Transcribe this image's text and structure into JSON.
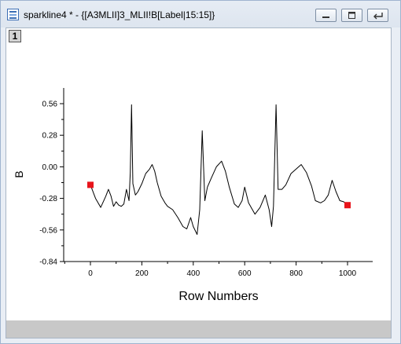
{
  "window": {
    "title": "sparkline4 * - {[A3MLII]3_MLII!B[Label|15:15]}",
    "layer_tab": "1",
    "buttons": [
      "minimize",
      "maximize",
      "restore"
    ]
  },
  "chart_data": {
    "type": "line",
    "title": "",
    "xlabel": "Row Numbers",
    "ylabel": "B",
    "xlim": [
      -100,
      1100
    ],
    "ylim": [
      -0.84,
      0.7
    ],
    "x_ticks": [
      0,
      200,
      400,
      600,
      800,
      1000
    ],
    "y_ticks": [
      0.56,
      0.28,
      0.0,
      -0.28,
      -0.56,
      -0.84
    ],
    "y_tick_labels": [
      "0.56",
      "0.28",
      "0.00",
      "-0.28",
      "-0.56",
      "-0.84"
    ],
    "line_color": "#000000",
    "marker_color": "#e8141b",
    "series": [
      {
        "points": [
          [
            0,
            -0.16
          ],
          [
            20,
            -0.28
          ],
          [
            40,
            -0.36
          ],
          [
            60,
            -0.26
          ],
          [
            70,
            -0.2
          ],
          [
            80,
            -0.26
          ],
          [
            90,
            -0.35
          ],
          [
            100,
            -0.31
          ],
          [
            110,
            -0.34
          ],
          [
            120,
            -0.35
          ],
          [
            130,
            -0.33
          ],
          [
            140,
            -0.2
          ],
          [
            150,
            -0.3
          ],
          [
            155,
            -0.05
          ],
          [
            160,
            0.55
          ],
          [
            165,
            -0.15
          ],
          [
            175,
            -0.25
          ],
          [
            185,
            -0.22
          ],
          [
            200,
            -0.15
          ],
          [
            215,
            -0.06
          ],
          [
            230,
            -0.02
          ],
          [
            240,
            0.02
          ],
          [
            250,
            -0.04
          ],
          [
            260,
            -0.14
          ],
          [
            275,
            -0.26
          ],
          [
            290,
            -0.32
          ],
          [
            300,
            -0.35
          ],
          [
            320,
            -0.38
          ],
          [
            340,
            -0.45
          ],
          [
            360,
            -0.53
          ],
          [
            375,
            -0.55
          ],
          [
            390,
            -0.45
          ],
          [
            400,
            -0.53
          ],
          [
            415,
            -0.6
          ],
          [
            425,
            -0.38
          ],
          [
            435,
            0.32
          ],
          [
            445,
            -0.3
          ],
          [
            455,
            -0.18
          ],
          [
            470,
            -0.1
          ],
          [
            490,
            0.0
          ],
          [
            510,
            0.05
          ],
          [
            525,
            -0.04
          ],
          [
            540,
            -0.18
          ],
          [
            560,
            -0.33
          ],
          [
            575,
            -0.36
          ],
          [
            590,
            -0.3
          ],
          [
            600,
            -0.18
          ],
          [
            615,
            -0.32
          ],
          [
            640,
            -0.42
          ],
          [
            660,
            -0.36
          ],
          [
            680,
            -0.25
          ],
          [
            695,
            -0.38
          ],
          [
            705,
            -0.53
          ],
          [
            712,
            -0.35
          ],
          [
            722,
            0.55
          ],
          [
            730,
            -0.2
          ],
          [
            745,
            -0.2
          ],
          [
            760,
            -0.16
          ],
          [
            780,
            -0.06
          ],
          [
            800,
            -0.02
          ],
          [
            820,
            0.02
          ],
          [
            840,
            -0.05
          ],
          [
            860,
            -0.17
          ],
          [
            875,
            -0.3
          ],
          [
            895,
            -0.32
          ],
          [
            910,
            -0.3
          ],
          [
            925,
            -0.25
          ],
          [
            940,
            -0.12
          ],
          [
            955,
            -0.22
          ],
          [
            970,
            -0.3
          ],
          [
            985,
            -0.31
          ],
          [
            1000,
            -0.34
          ]
        ]
      }
    ],
    "highlighted_points": [
      [
        0,
        -0.16
      ],
      [
        1000,
        -0.34
      ]
    ]
  }
}
